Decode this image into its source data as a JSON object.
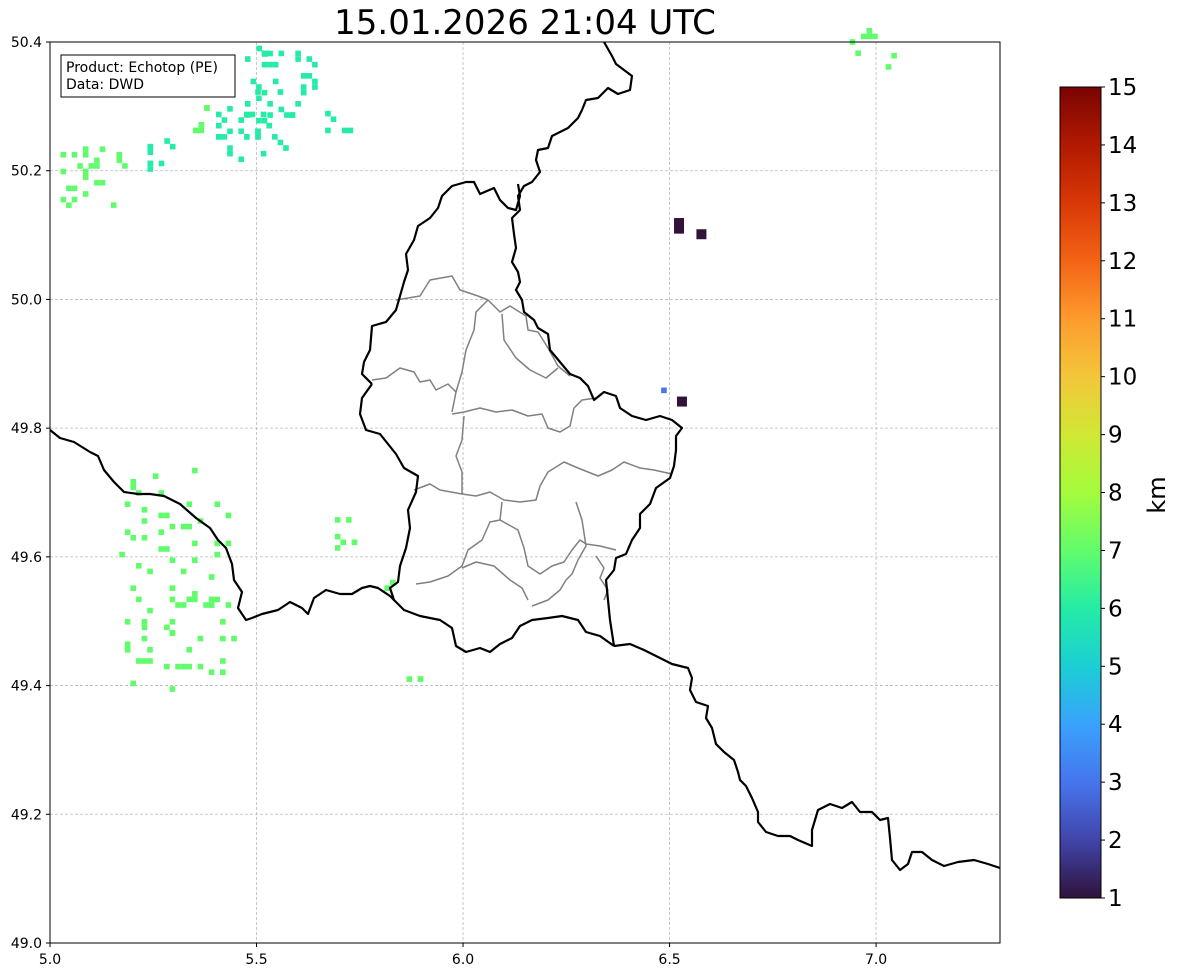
{
  "title": "15.01.2026 21:04 UTC",
  "info_box": {
    "product_line": "Product: Echotop (PE)",
    "data_line": "Data: DWD"
  },
  "map_extent": {
    "lon": [
      5.0,
      7.3
    ],
    "lat": [
      49.0,
      50.4
    ]
  },
  "x_ticks": [
    "5.0",
    "5.5",
    "6.0",
    "6.5",
    "7.0"
  ],
  "x_tick_values": [
    5.0,
    5.5,
    6.0,
    6.5,
    7.0
  ],
  "y_ticks": [
    "50.4",
    "50.2",
    "50.0",
    "49.8",
    "49.6",
    "49.4",
    "49.2",
    "49.0"
  ],
  "y_tick_values": [
    50.4,
    50.2,
    50.0,
    49.8,
    49.6,
    49.4,
    49.2,
    49.0
  ],
  "grid": true,
  "colorbar": {
    "label": "km",
    "range": [
      1,
      15
    ],
    "ticks": [
      "15",
      "14",
      "13",
      "12",
      "11",
      "10",
      "9",
      "8",
      "7",
      "6",
      "5",
      "4",
      "3",
      "2",
      "1"
    ],
    "tick_values": [
      15,
      14,
      13,
      12,
      11,
      10,
      9,
      8,
      7,
      6,
      5,
      4,
      3,
      2,
      1
    ],
    "colormap": "turbo",
    "colors": [
      "#30123b",
      "#4145ab",
      "#4675ed",
      "#39a2fc",
      "#1bcfd4",
      "#24eca6",
      "#61fc6c",
      "#a4fc3b",
      "#d1e834",
      "#f3c63a",
      "#fe9b2d",
      "#f36315",
      "#d93806",
      "#b11901",
      "#7a0403"
    ]
  },
  "echo_cells": [
    {
      "lon": 5.1,
      "lat": 50.19,
      "value_km": 6.7
    },
    {
      "lon": 5.27,
      "lat": 50.22,
      "value_km": 5.8
    },
    {
      "lon": 5.38,
      "lat": 50.28,
      "value_km": 7.0
    },
    {
      "lon": 5.49,
      "lat": 50.27,
      "value_km": 6.3
    },
    {
      "lon": 5.56,
      "lat": 50.33,
      "value_km": 6.0
    },
    {
      "lon": 5.52,
      "lat": 50.39,
      "value_km": 6.1
    },
    {
      "lon": 5.7,
      "lat": 50.28,
      "value_km": 6.4
    },
    {
      "lon": 6.97,
      "lat": 50.4,
      "value_km": 7.2
    },
    {
      "lon": 7.03,
      "lat": 50.37,
      "value_km": 7.2
    },
    {
      "lon": 6.55,
      "lat": 50.11,
      "value_km": 1.2
    },
    {
      "lon": 6.5,
      "lat": 49.85,
      "value_km": 3.3
    },
    {
      "lon": 6.53,
      "lat": 49.85,
      "value_km": 1.2
    },
    {
      "lon": 5.31,
      "lat": 49.56,
      "value_km": 7.0
    },
    {
      "lon": 5.71,
      "lat": 49.64,
      "value_km": 6.8
    },
    {
      "lon": 5.83,
      "lat": 49.56,
      "value_km": 6.7
    },
    {
      "lon": 5.87,
      "lat": 49.41,
      "value_km": 7.2
    }
  ]
}
